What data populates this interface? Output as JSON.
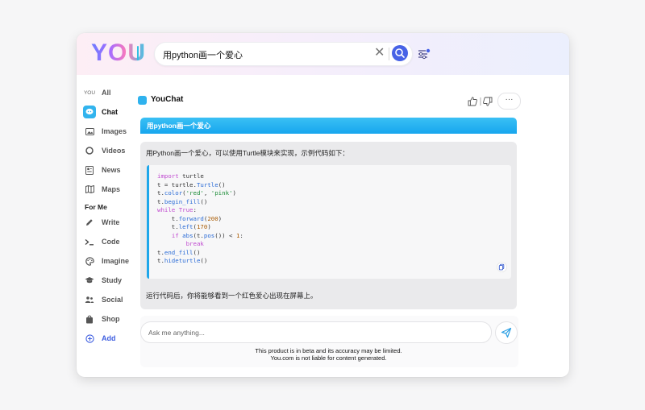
{
  "brand": {
    "logo_text": "YOU"
  },
  "search": {
    "query": "用python画一个爱心",
    "clear_glyph": "✕"
  },
  "sidebar": {
    "items": [
      {
        "label": "All",
        "icon": "you-badge-icon",
        "badge": "YOU"
      },
      {
        "label": "Chat",
        "icon": "chat-icon",
        "active": true
      },
      {
        "label": "Images",
        "icon": "image-icon"
      },
      {
        "label": "Videos",
        "icon": "video-icon"
      },
      {
        "label": "News",
        "icon": "news-icon"
      },
      {
        "label": "Maps",
        "icon": "map-icon"
      }
    ],
    "section_label": "For Me",
    "me_items": [
      {
        "label": "Write",
        "icon": "pencil-icon"
      },
      {
        "label": "Code",
        "icon": "terminal-icon"
      },
      {
        "label": "Imagine",
        "icon": "palette-icon"
      },
      {
        "label": "Study",
        "icon": "graduation-cap-icon"
      },
      {
        "label": "Social",
        "icon": "people-icon"
      },
      {
        "label": "Shop",
        "icon": "shopping-bag-icon"
      }
    ],
    "add_label": "Add"
  },
  "chat": {
    "title": "YouChat",
    "more_glyph": "···",
    "query": "用python画一个爱心",
    "answer_intro": "用Python画一个爱心，可以使用Turtle模块来实现，示例代码如下：",
    "code_lines": [
      "import turtle",
      "t = turtle.Turtle()",
      "t.color('red', 'pink')",
      "t.begin_fill()",
      "while True:",
      "    t.forward(200)",
      "    t.left(170)",
      "    if abs(t.pos()) < 1:",
      "        break",
      "t.end_fill()",
      "t.hideturtle()"
    ],
    "answer_outro": "运行代码后，你将能够看到一个红色爱心出现在屏幕上。"
  },
  "composer": {
    "placeholder": "Ask me anything..."
  },
  "disclaimer": {
    "line1": "This product is in beta and its accuracy may be limited.",
    "line2": "You.com is not liable for content generated."
  },
  "colors": {
    "accent": "#1fa7ea",
    "search_button": "#4762e6",
    "add_link": "#3f5fe0"
  }
}
